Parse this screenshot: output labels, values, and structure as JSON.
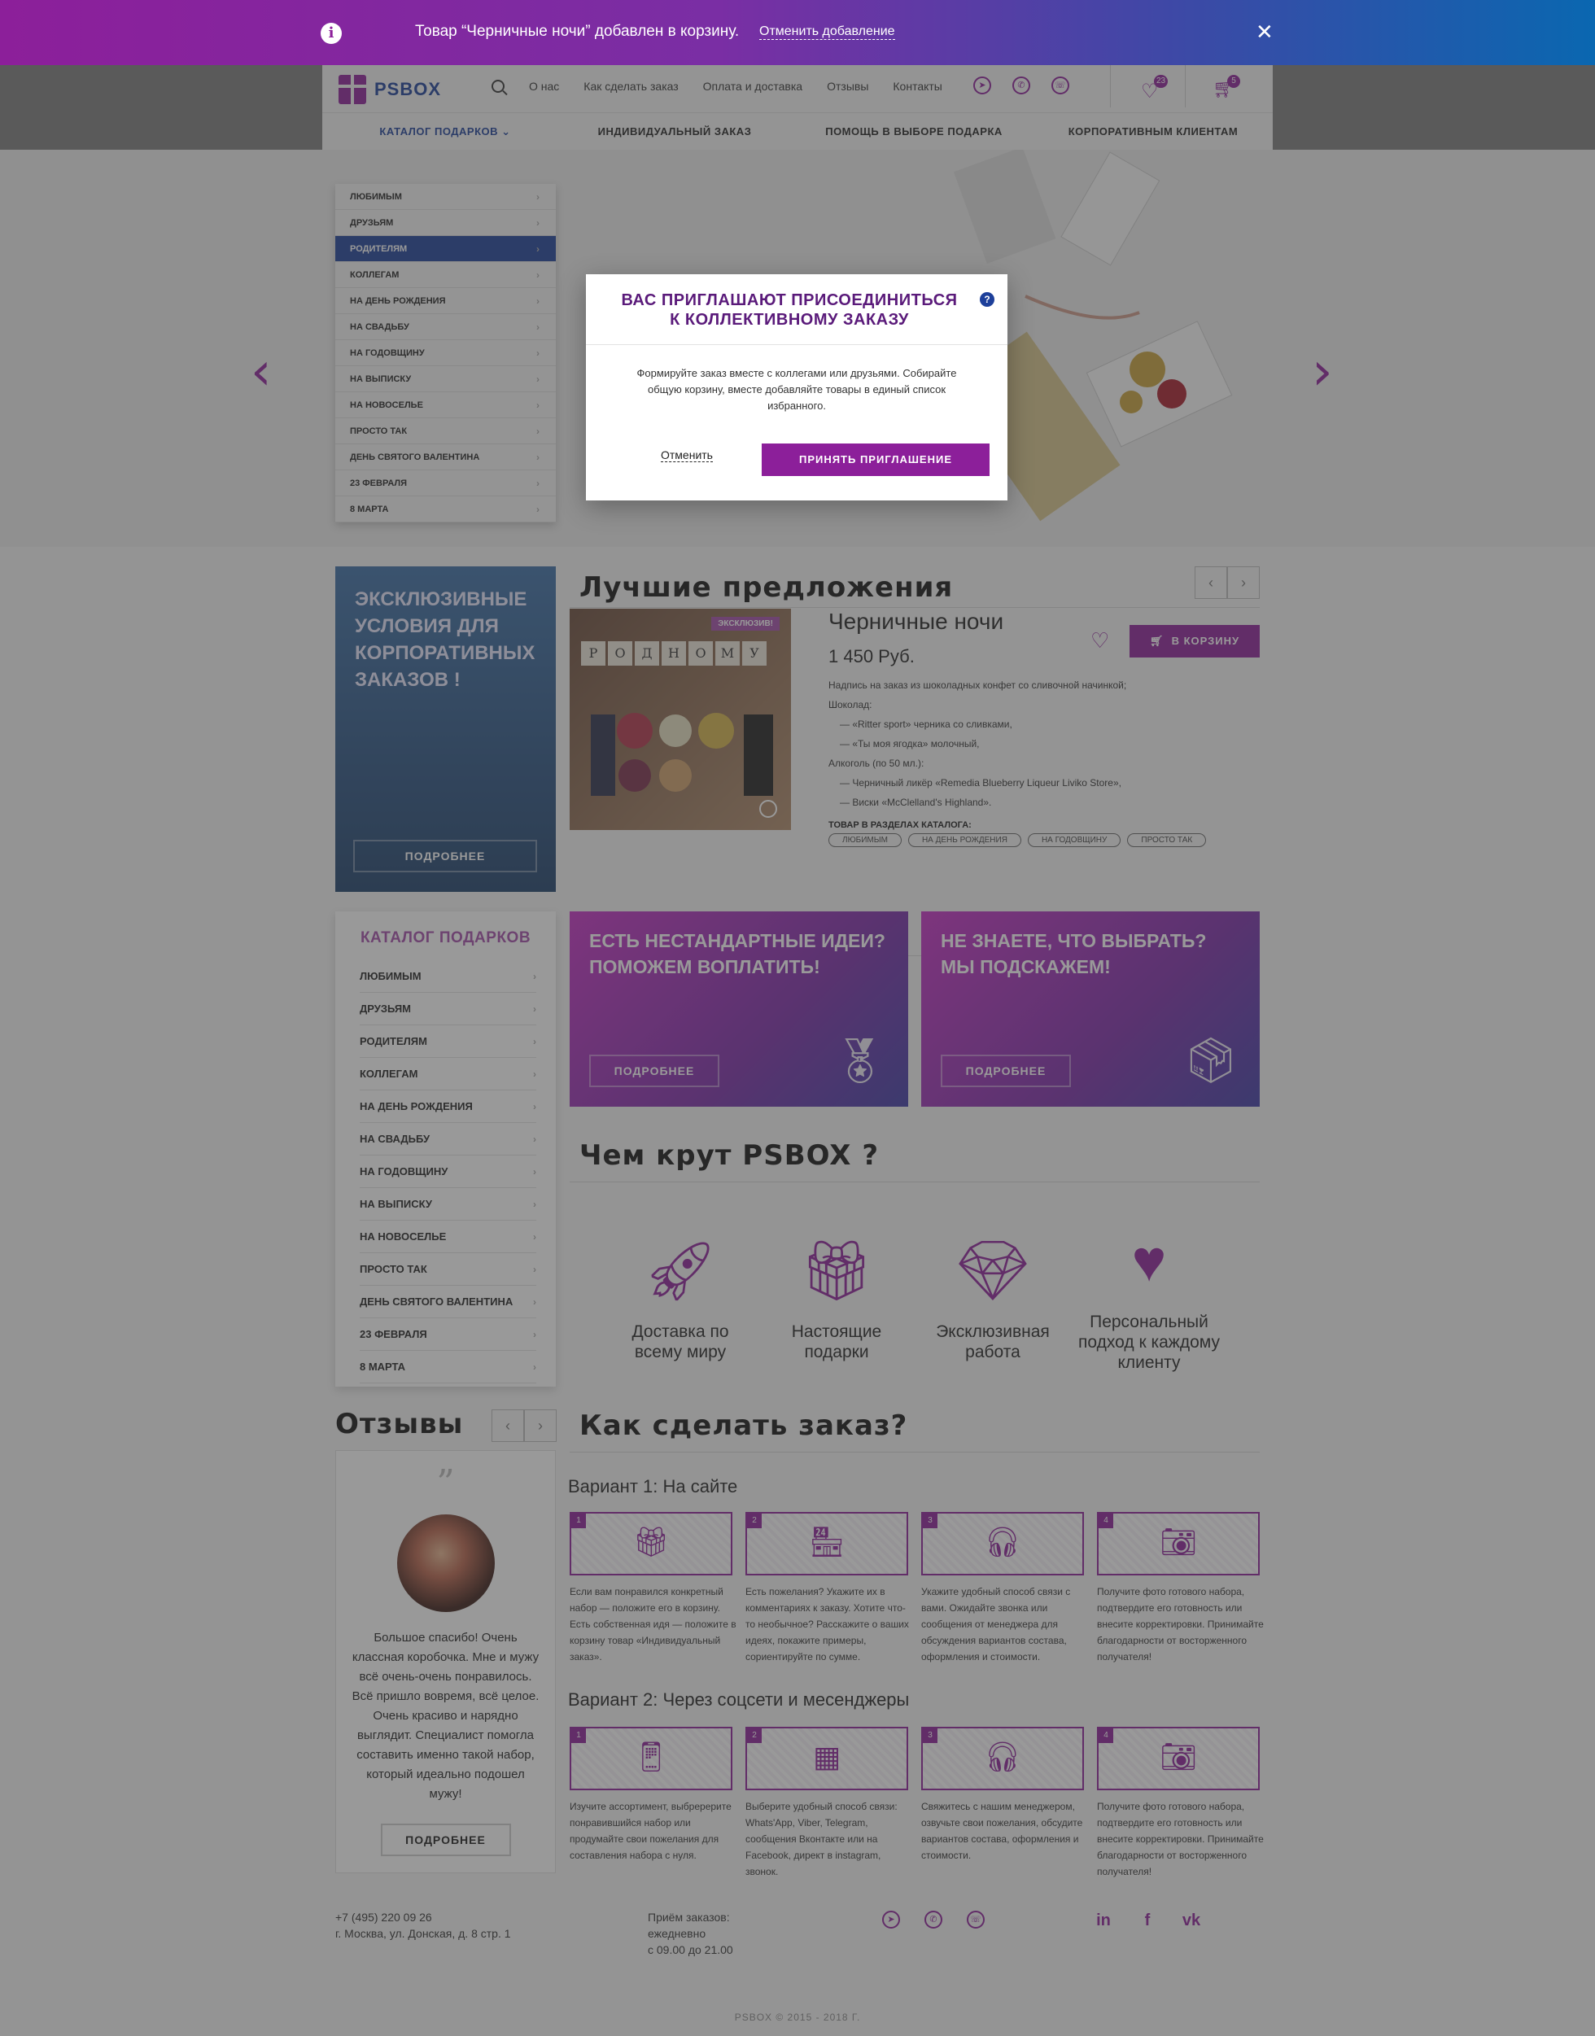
{
  "notification": {
    "message": "Товар “Черничные ночи” добавлен в корзину.",
    "undo": "Отменить добавление",
    "info_symbol": "i",
    "close_symbol": "✕"
  },
  "header": {
    "logo": "PSBOX",
    "nav": [
      "О нас",
      "Как сделать заказ",
      "Оплата и доставка",
      "Отзывы",
      "Контакты"
    ],
    "favorites_count": "23",
    "cart_count": "5",
    "subnav": {
      "catalog": "КАТАЛОГ ПОДАРКОВ",
      "items": [
        "ИНДИВИДУАЛЬНЫЙ ЗАКАЗ",
        "ПОМОЩЬ В ВЫБОРЕ ПОДАРКА",
        "КОРПОРАТИВНЫМ КЛИЕНТАМ"
      ]
    }
  },
  "catalog_dropdown": [
    "ЛЮБИМЫМ",
    "ДРУЗЬЯМ",
    "РОДИТЕЛЯМ",
    "КОЛЛЕГАМ",
    "НА ДЕНЬ РОЖДЕНИЯ",
    "НА СВАДЬБУ",
    "НА ГОДОВЩИНУ",
    "НА ВЫПИСКУ",
    "НА НОВОСЕЛЬЕ",
    "ПРОСТО ТАК",
    "ДЕНЬ СВЯТОГО ВАЛЕНТИНА",
    "23 ФЕВРАЛЯ",
    "8 МАРТА"
  ],
  "modal": {
    "title": "ВАС ПРИГЛАШАЮТ ПРИСОЕДИНИТЬСЯ К КОЛЛЕКТИВНОМУ ЗАКАЗУ",
    "help": "?",
    "text": "Формируйте заказ вместе с коллегами или друзьями. Собирайте общую корзину, вместе добавляйте товары в единый список избранного.",
    "cancel": "Отменить",
    "accept": "ПРИНЯТЬ ПРИГЛАШЕНИЕ"
  },
  "promo_side": {
    "title": "ЭКСКЛЮЗИВНЫЕ УСЛОВИЯ ДЛЯ КОРПОРАТИВНЫХ ЗАКАЗОВ !",
    "more": "ПОДРОБНЕЕ"
  },
  "best": {
    "title": "Лучшие предложения",
    "product": {
      "badge": "ЭКСКЛЮЗИВ!",
      "letters": [
        "Р",
        "О",
        "Д",
        "Н",
        "О",
        "М",
        "У"
      ],
      "name": "Черничные ночи",
      "price": "1 450 Руб.",
      "to_cart": "В КОРЗИНУ",
      "desc": [
        "Надпись на заказ из шоколадных конфет со сливочной начинкой;",
        "Шоколад:",
        "— «Ritter sport» черника со сливками,",
        "— «Ты моя ягодка» молочный,",
        "Алкоголь (по 50 мл.):",
        "— Черничный ликёр «Remedia Blueberry Liqueur Liviko Store»,",
        "— Виски «McClelland's Highland»."
      ],
      "cats_title": "ТОВАР В РАЗДЕЛАХ КАТАЛОГА:",
      "tags": [
        "ЛЮБИМЫМ",
        "НА ДЕНЬ РОЖДЕНИЯ",
        "НА ГОДОВЩИНУ",
        "ПРОСТО ТАК"
      ]
    }
  },
  "catalog_box": {
    "title": "КАТАЛОГ ПОДАРКОВ",
    "items": [
      "ЛЮБИМЫМ",
      "ДРУЗЬЯМ",
      "РОДИТЕЛЯМ",
      "КОЛЛЕГАМ",
      "НА ДЕНЬ РОЖДЕНИЯ",
      "НА СВАДЬБУ",
      "НА ГОДОВЩИНУ",
      "НА ВЫПИСКУ",
      "НА НОВОСЕЛЬЕ",
      "ПРОСТО ТАК",
      "ДЕНЬ СВЯТОГО ВАЛЕНТИНА",
      "23 ФЕВРАЛЯ",
      "8 МАРТА"
    ]
  },
  "banners": [
    {
      "title": "ЕСТЬ НЕСТАНДАРТНЫЕ ИДЕИ? ПОМОЖЕМ ВОПЛАТИТЬ!",
      "more": "ПОДРОБНЕЕ",
      "icon": "medal-icon"
    },
    {
      "title": "НЕ ЗНАЕТЕ, ЧТО ВЫБРАТЬ? МЫ ПОДСКАЖЕМ!",
      "more": "ПОДРОБНЕЕ",
      "icon": "box-icon"
    }
  ],
  "why": {
    "title": "Чем крут PSBOX ?",
    "features": [
      {
        "icon": "rocket-icon",
        "label": "Доставка по всему миру"
      },
      {
        "icon": "gift-icon",
        "label": "Настоящие подарки"
      },
      {
        "icon": "diamond-icon",
        "label": "Эксклюзивная работа"
      },
      {
        "icon": "heart-hands-icon",
        "label": "Персональный подход к каждому клиенту"
      }
    ]
  },
  "reviews": {
    "title": "Отзывы",
    "quote_mark": "”",
    "text": "Большое спасибо! Очень классная коробочка. Мне и мужу всё очень-очень понравилось. Всё пришло вовремя, всё целое. Очень красиво и нарядно выглядит. Специалист помогла составить именно такой набор, который идеально подошел мужу!",
    "more": "ПОДРОБНЕЕ"
  },
  "how": {
    "title": "Как сделать заказ?",
    "variant1": {
      "title": "Вариант 1: На сайте",
      "steps": [
        {
          "num": "1",
          "icon": "gift-icon",
          "text": "Если вам понравился конкретный набор — положите его в корзину. Есть собственная идя — положите в корзину товар «Индивидуальный заказ»."
        },
        {
          "num": "2",
          "icon": "store-icon",
          "text": "Есть пожелания? Укажите их в комментариях к заказу. Хотите что-то необычное? Расскажите о ваших идеях, покажите примеры, сориентируйте по сумме."
        },
        {
          "num": "3",
          "icon": "operator-icon",
          "text": "Укажите удобный способ связи с вами. Ожидайте звонка или сообщения от менеджера для обсуждения вариантов состава, оформления и стоимости."
        },
        {
          "num": "4",
          "icon": "camera-icon",
          "text": "Получите фото готового набора, подтвердите его готовность или внесите корректировки. Принимайте благодарности от восторженного получателя!"
        }
      ]
    },
    "variant2": {
      "title": "Вариант 2: Через соцсети и месенджеры",
      "steps": [
        {
          "num": "1",
          "icon": "phone-store-icon",
          "text": "Изучите ассортимент, выбререрите понравившийся набор или продумайте свои пожелания для составления набора с нуля."
        },
        {
          "num": "2",
          "icon": "qr-icon",
          "text": "Выберите удобный способ связи: Whats'App, Viber, Telegram, сообщения Вконтакте или на Facebook, директ в instagram, звонок."
        },
        {
          "num": "3",
          "icon": "operator-icon",
          "text": "Свяжитесь с нашим менеджером, озвучьте свои пожелания, обсудите вариантов состава, оформления и стоимости."
        },
        {
          "num": "4",
          "icon": "camera-icon",
          "text": "Получите фото готового набора, подтвердите его готовность или внесите корректировки. Принимайте благодарности от восторженного получателя!"
        }
      ]
    }
  },
  "footer": {
    "phone": "+7 (495) 220 09 26",
    "address": "г. Москва, ул. Донская, д. 8 стр. 1",
    "hours_label": "Приём заказов:",
    "hours_days": "ежедневно",
    "hours_time": "с 09.00 до 21.00",
    "copyright": "PSBOX © 2015 - 2018 Г."
  },
  "colors": {
    "accent": "#8c1f9a",
    "brand_blue": "#1d3f9a"
  }
}
